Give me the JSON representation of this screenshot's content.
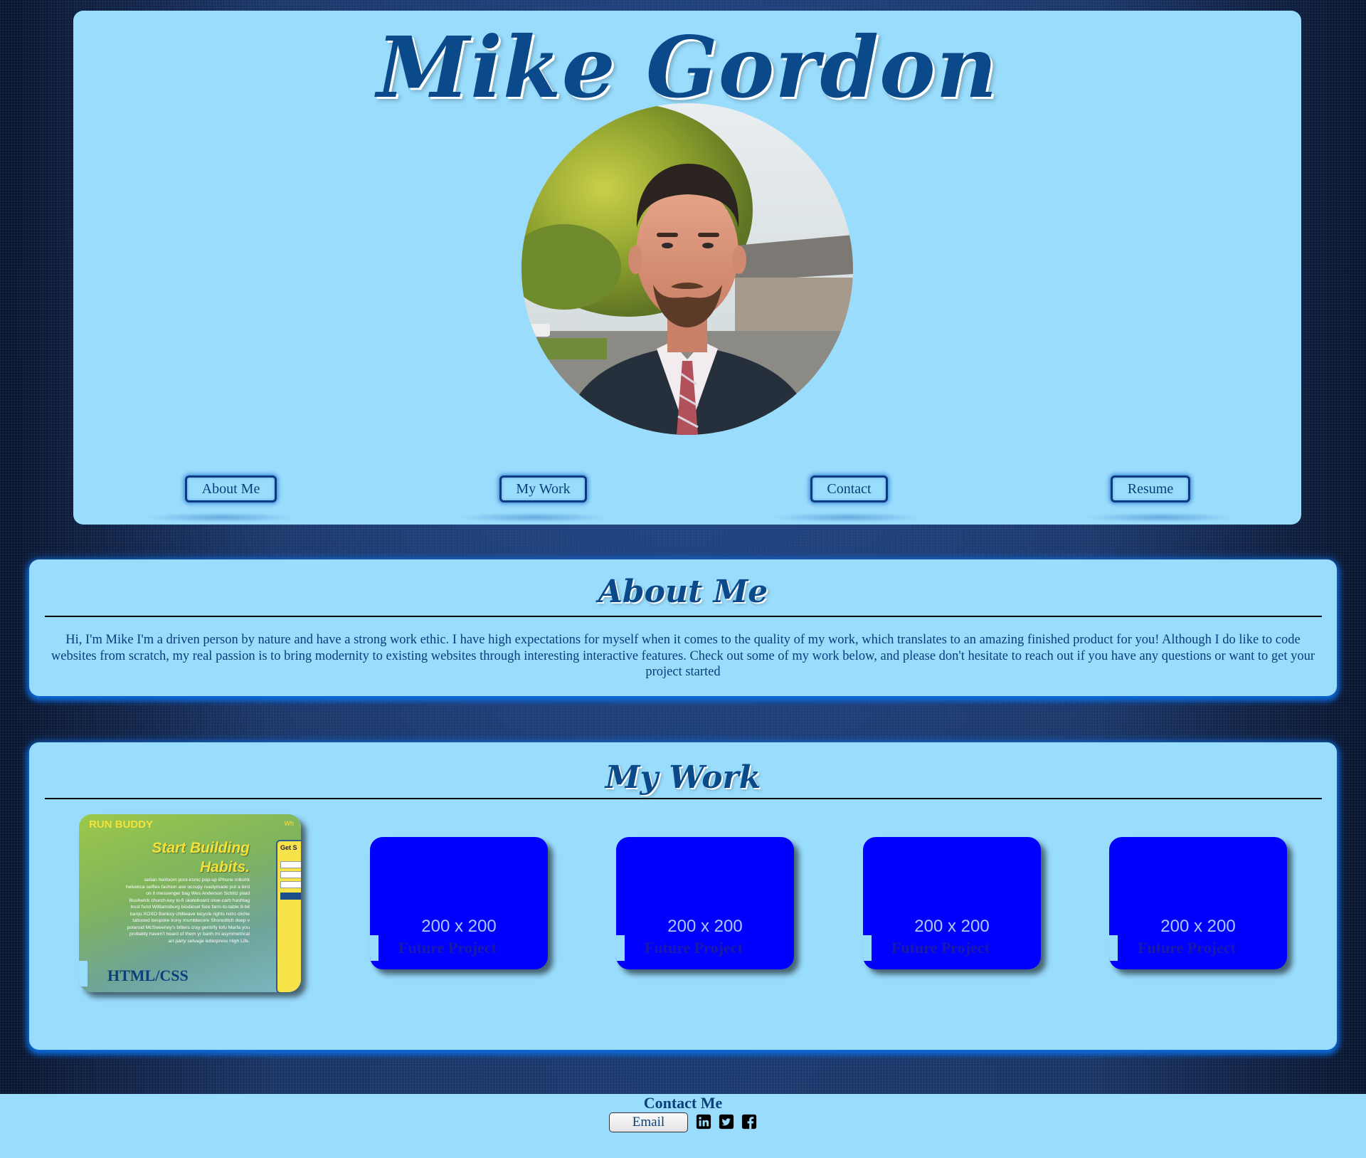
{
  "header": {
    "name": "Mike Gordon",
    "nav": [
      {
        "label": "About Me"
      },
      {
        "label": "My Work"
      },
      {
        "label": "Contact"
      },
      {
        "label": "Resume"
      }
    ]
  },
  "about": {
    "title": "About Me",
    "text": "Hi, I'm Mike I'm a driven person by nature and have a strong work ethic. I have high expectations for myself when it comes to the quality of my work, which translates to an amazing finished product for you! Although I do like to code websites from scratch, my real passion is to bring modernity to existing websites through interesting interactive features. Check out some of my work below, and please don't hesitate to reach out if you have any questions or want to get your project started"
  },
  "work": {
    "title": "My Work",
    "featured": {
      "label": "HTML/CSS",
      "preview": {
        "logo": "RUN BUDDY",
        "nav": "Wh",
        "headline_1": "Start Building",
        "headline_2": "Habits.",
        "body": "seitan heirloom post-ironic pop-up iPhone mlkshk helvetica selfies fashion axe occupy readymade put a bird on it messenger bag Wes Anderson Schlitz plaid Bushwick church-key lo-fi skateboard slow-carb hashtag trust fund Williamsburg biodiesel fixie farm-to-table 8-bit banjo XOXO Banksy chillwave bicycle rights retro cliche tattooed bespoke irony mumblecore Shoreditch deep v polaroid McSweeney's bitters cray gentrify tofu Marfa you probably haven't heard of them yr banh mi asymmetrical art party selvage letterpress High Life.",
        "form_title": "Get S"
      }
    },
    "future": [
      {
        "size": "200 x 200",
        "label": "Future Project"
      },
      {
        "size": "200 x 200",
        "label": "Future Project"
      },
      {
        "size": "200 x 200",
        "label": "Future Project"
      },
      {
        "size": "200 x 200",
        "label": "Future Project"
      }
    ]
  },
  "footer": {
    "title": "Contact Me",
    "email_label": "Email",
    "icons": [
      "linkedin-icon",
      "twitter-icon",
      "facebook-icon"
    ]
  },
  "colors": {
    "panel": "#99dcfc",
    "heading": "#0a4a8a",
    "future_card": "#0000ff",
    "glow": "#0a6ee6"
  }
}
